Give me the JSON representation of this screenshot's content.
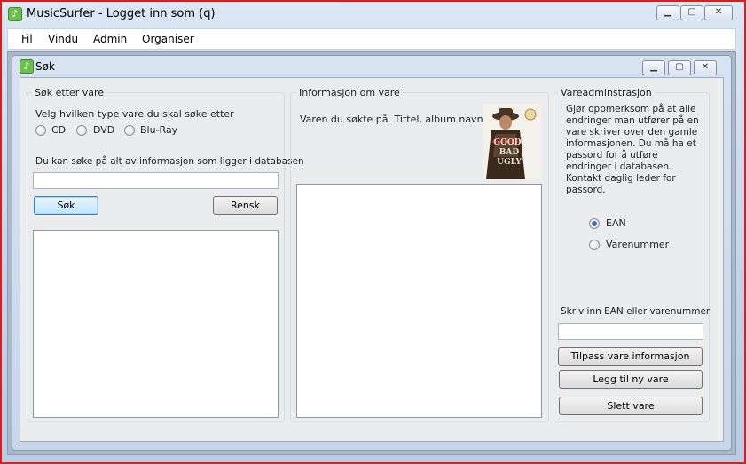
{
  "window": {
    "title": "MusicSurfer - Logget inn som (q)",
    "icon": "music-app-icon"
  },
  "menu": {
    "items": [
      "Fil",
      "Vindu",
      "Admin",
      "Organiser"
    ]
  },
  "child_window": {
    "title": "Søk",
    "icon": "music-app-icon"
  },
  "search_group": {
    "legend": "Søk etter vare",
    "type_prompt": "Velg hvilken type vare du skal søke etter",
    "type_options": [
      {
        "label": "CD",
        "checked": false
      },
      {
        "label": "DVD",
        "checked": false
      },
      {
        "label": "Blu-Ray",
        "checked": false
      }
    ],
    "info_text": "Du kan søke på alt av informasjon som ligger i databasen",
    "search_value": "",
    "search_button": "Søk",
    "clear_button": "Rensk",
    "results": []
  },
  "info_group": {
    "legend": "Informasjon om vare",
    "description": "Varen du søkte på. Tittel, album navn etc",
    "cover_image": {
      "lettering": "THE GOOD THE BAD THE UGLY",
      "colors": [
        "#3a2a1c",
        "#c8c2b4",
        "#b01e1e"
      ]
    },
    "details": []
  },
  "admin_group": {
    "legend": "Vareadminstrasjon",
    "notice": "Gjør oppmerksom på at alle endringer man utfører på en vare skriver over den gamle informasjonen. Du må ha et passord for å utføre endringer i databasen. Kontakt daglig leder for passord.",
    "id_options": [
      {
        "label": "EAN",
        "checked": true
      },
      {
        "label": "Varenummer",
        "checked": false
      }
    ],
    "input_label": "Skriv inn EAN eller varenummer",
    "input_value": "",
    "buttons": {
      "update": "Tilpass vare informasjon",
      "add": "Legg til ny vare",
      "delete": "Slett vare"
    }
  },
  "colors": {
    "accent": "#3d6fb6",
    "frame_border": "#d61f1f",
    "app_icon": "#6cbf4a"
  }
}
